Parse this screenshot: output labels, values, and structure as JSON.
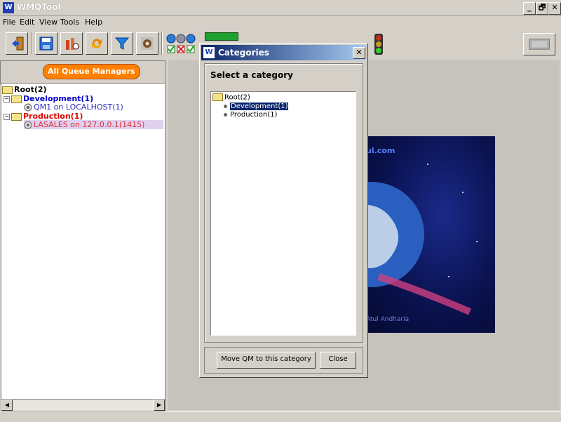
{
  "window": {
    "title": "WMQTool",
    "logo": "W",
    "controls": [
      "_",
      "🗗",
      "✕"
    ]
  },
  "menu": [
    "File",
    "Edit",
    "View",
    "Tools",
    "Help"
  ],
  "toolbar": {
    "icons": [
      "exit-icon",
      "save-icon",
      "connect-icon",
      "refresh-icon",
      "filter-icon",
      "settings-icon",
      "queue-status-icon",
      "battery-icon",
      "traffic-light-icon",
      "monitor-icon"
    ]
  },
  "left_panel": {
    "all_queue_managers_label": "All Queue Managers",
    "tree": {
      "root": "Root(2)",
      "development": "Development(1)",
      "development_qm": "QM1 on LOCALHOST(1)",
      "production": "Production(1)",
      "production_qm": "LASALES on 127.0.0.1(1415)"
    }
  },
  "splash": {
    "site": "ul.com",
    "author": "Atul Andharia"
  },
  "dialog": {
    "title": "Categories",
    "logo": "W",
    "close_glyph": "✕",
    "heading": "Select a category",
    "tree": {
      "root": "Root(2)",
      "development": "Development(1)",
      "production": "Production(1)"
    },
    "move_button": "Move QM to this category",
    "close_button": "Close"
  },
  "colors": {
    "development": "#0000cc",
    "production": "#e00000",
    "qm_dev": "#3030c0",
    "qm_prod": "#e03030",
    "selection": "#0a246a"
  }
}
